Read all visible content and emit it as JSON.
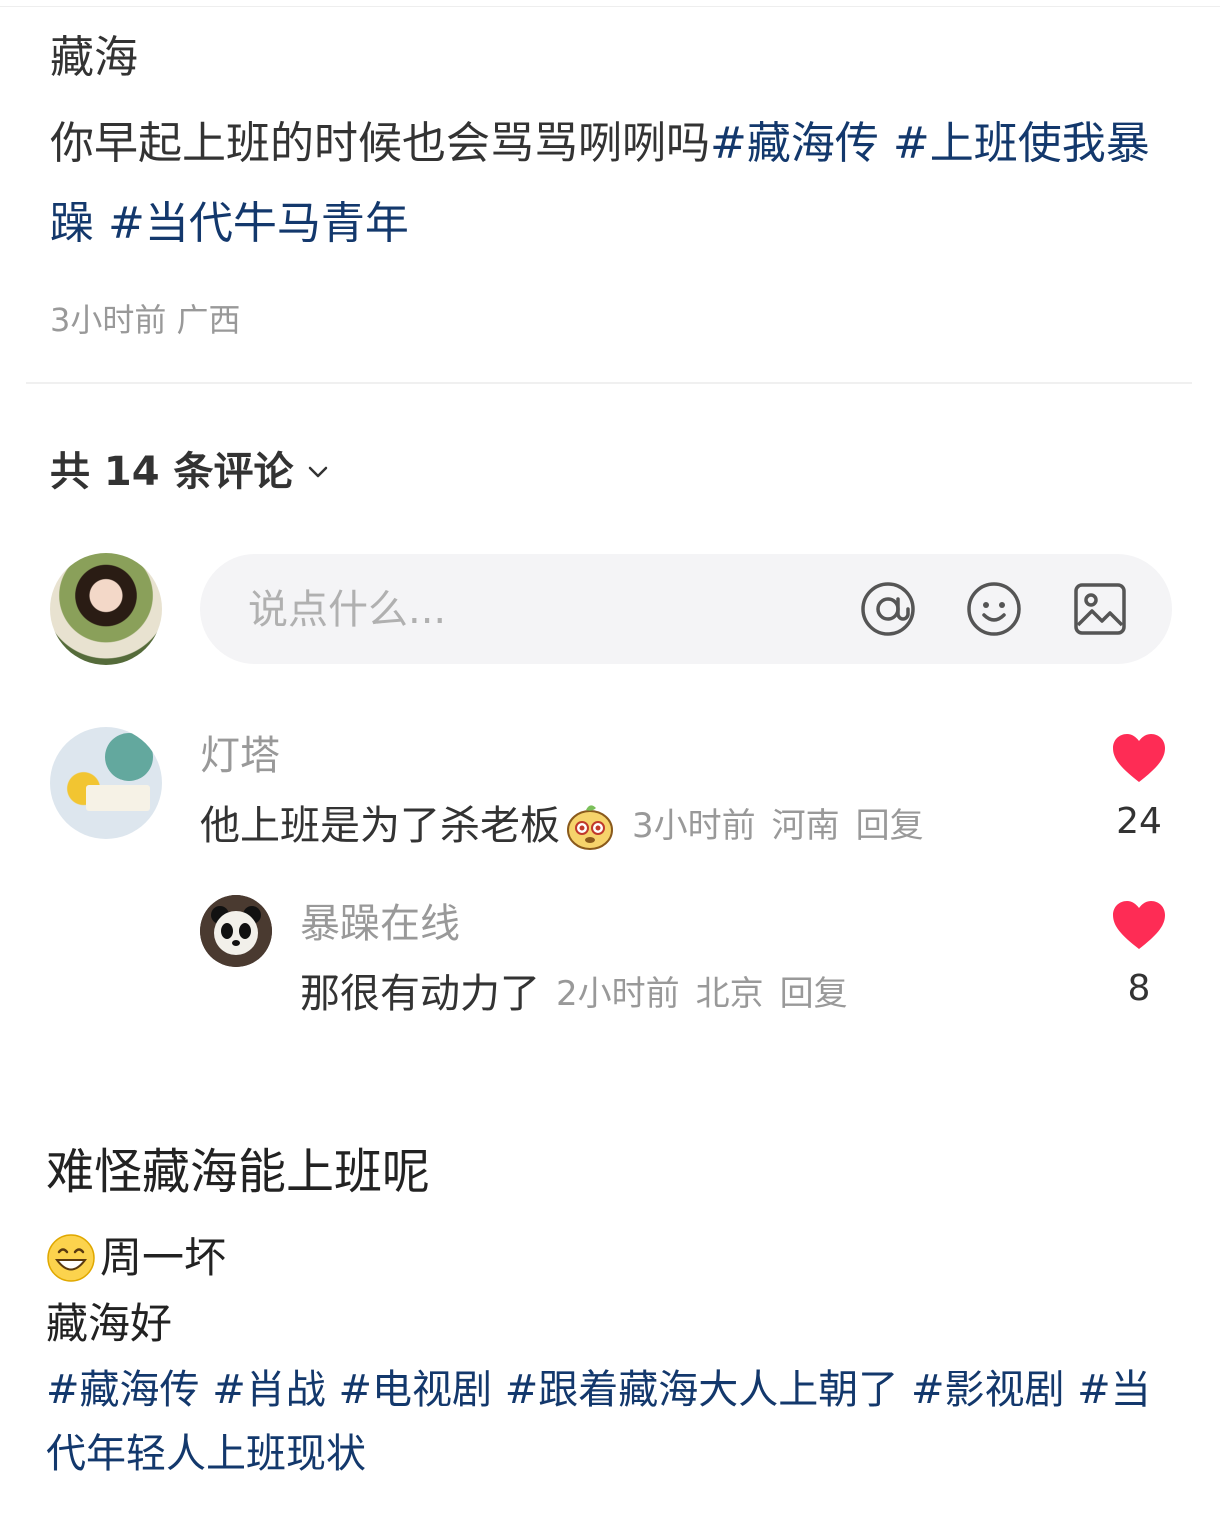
{
  "post": {
    "title": "藏海",
    "body_text": "你早起上班的时候也会骂骂咧咧吗",
    "hashtags": [
      "#藏海传",
      "#上班使我暴躁",
      "#当代牛马青年"
    ],
    "time": "3小时前",
    "location": "广西"
  },
  "comments_header": {
    "label": "共 14 条评论",
    "chevron_icon": "chevron-down-icon"
  },
  "comment_input": {
    "placeholder": "说点什么...",
    "icons": [
      "at-icon",
      "emoji-icon",
      "image-icon"
    ]
  },
  "comments": [
    {
      "username": "灯塔",
      "text": "他上班是为了杀老板",
      "sticker": "cartoon-sticker-icon",
      "time": "3小时前",
      "location": "河南",
      "reply_label": "回复",
      "likes": "24",
      "replies": [
        {
          "username": "暴躁在线",
          "text": "那很有动力了",
          "time": "2小时前",
          "location": "北京",
          "reply_label": "回复",
          "likes": "8"
        }
      ]
    }
  ],
  "next_post": {
    "title": "难怪藏海能上班呢",
    "line1_emoji": "grinning-emoji-icon",
    "line1_text": "周一坏",
    "line2_text": "藏海好",
    "hashtags": [
      "#藏海传",
      "#肖战",
      "#电视剧",
      "#跟着藏海大人上朝了",
      "#影视剧",
      "#当代年轻人上班现状"
    ]
  },
  "colors": {
    "hashtag": "#13386c",
    "like_heart": "#fe2c55",
    "meta_text": "#999999",
    "input_bg": "#f4f4f6"
  }
}
